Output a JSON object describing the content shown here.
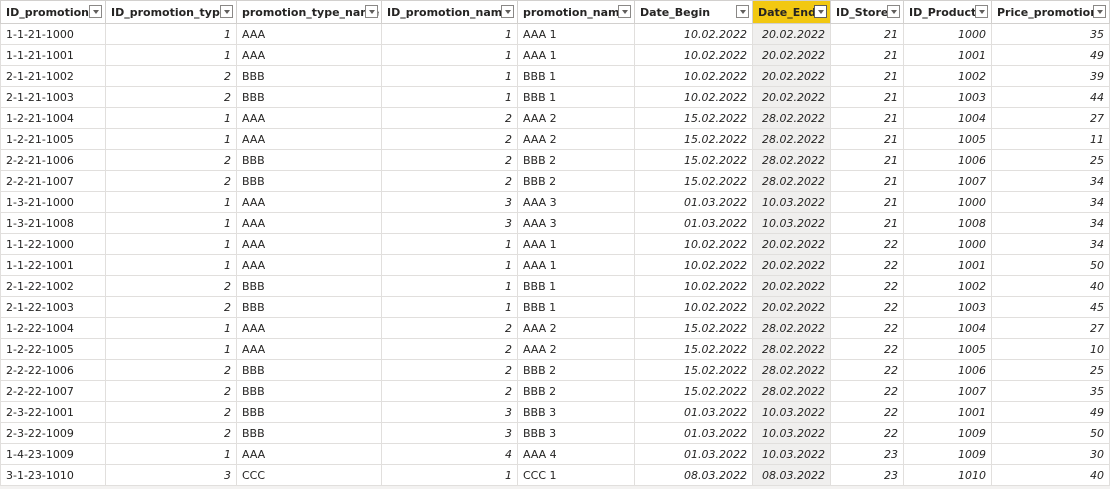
{
  "columns": [
    {
      "label": "ID_promotion",
      "align": "txt"
    },
    {
      "label": "ID_promotion_type",
      "align": "num"
    },
    {
      "label": "promotion_type_name",
      "align": "txt"
    },
    {
      "label": "ID_promotion_name",
      "align": "num"
    },
    {
      "label": "promotion_name",
      "align": "txt"
    },
    {
      "label": "Date_Begin",
      "align": "num"
    },
    {
      "label": "Date_End",
      "align": "num",
      "active": true
    },
    {
      "label": "ID_Store",
      "align": "num"
    },
    {
      "label": "ID_Product",
      "align": "num"
    },
    {
      "label": "Price_promotion",
      "align": "num"
    }
  ],
  "rows": [
    [
      "1-1-21-1000",
      "1",
      "AAA",
      "1",
      "AAA 1",
      "10.02.2022",
      "20.02.2022",
      "21",
      "1000",
      "35"
    ],
    [
      "1-1-21-1001",
      "1",
      "AAA",
      "1",
      "AAA 1",
      "10.02.2022",
      "20.02.2022",
      "21",
      "1001",
      "49"
    ],
    [
      "2-1-21-1002",
      "2",
      "BBB",
      "1",
      "BBB 1",
      "10.02.2022",
      "20.02.2022",
      "21",
      "1002",
      "39"
    ],
    [
      "2-1-21-1003",
      "2",
      "BBB",
      "1",
      "BBB 1",
      "10.02.2022",
      "20.02.2022",
      "21",
      "1003",
      "44"
    ],
    [
      "1-2-21-1004",
      "1",
      "AAA",
      "2",
      "AAA 2",
      "15.02.2022",
      "28.02.2022",
      "21",
      "1004",
      "27"
    ],
    [
      "1-2-21-1005",
      "1",
      "AAA",
      "2",
      "AAA 2",
      "15.02.2022",
      "28.02.2022",
      "21",
      "1005",
      "11"
    ],
    [
      "2-2-21-1006",
      "2",
      "BBB",
      "2",
      "BBB 2",
      "15.02.2022",
      "28.02.2022",
      "21",
      "1006",
      "25"
    ],
    [
      "2-2-21-1007",
      "2",
      "BBB",
      "2",
      "BBB 2",
      "15.02.2022",
      "28.02.2022",
      "21",
      "1007",
      "34"
    ],
    [
      "1-3-21-1000",
      "1",
      "AAA",
      "3",
      "AAA 3",
      "01.03.2022",
      "10.03.2022",
      "21",
      "1000",
      "34"
    ],
    [
      "1-3-21-1008",
      "1",
      "AAA",
      "3",
      "AAA 3",
      "01.03.2022",
      "10.03.2022",
      "21",
      "1008",
      "34"
    ],
    [
      "1-1-22-1000",
      "1",
      "AAA",
      "1",
      "AAA 1",
      "10.02.2022",
      "20.02.2022",
      "22",
      "1000",
      "34"
    ],
    [
      "1-1-22-1001",
      "1",
      "AAA",
      "1",
      "AAA 1",
      "10.02.2022",
      "20.02.2022",
      "22",
      "1001",
      "50"
    ],
    [
      "2-1-22-1002",
      "2",
      "BBB",
      "1",
      "BBB 1",
      "10.02.2022",
      "20.02.2022",
      "22",
      "1002",
      "40"
    ],
    [
      "2-1-22-1003",
      "2",
      "BBB",
      "1",
      "BBB 1",
      "10.02.2022",
      "20.02.2022",
      "22",
      "1003",
      "45"
    ],
    [
      "1-2-22-1004",
      "1",
      "AAA",
      "2",
      "AAA 2",
      "15.02.2022",
      "28.02.2022",
      "22",
      "1004",
      "27"
    ],
    [
      "1-2-22-1005",
      "1",
      "AAA",
      "2",
      "AAA 2",
      "15.02.2022",
      "28.02.2022",
      "22",
      "1005",
      "10"
    ],
    [
      "2-2-22-1006",
      "2",
      "BBB",
      "2",
      "BBB 2",
      "15.02.2022",
      "28.02.2022",
      "22",
      "1006",
      "25"
    ],
    [
      "2-2-22-1007",
      "2",
      "BBB",
      "2",
      "BBB 2",
      "15.02.2022",
      "28.02.2022",
      "22",
      "1007",
      "35"
    ],
    [
      "2-3-22-1001",
      "2",
      "BBB",
      "3",
      "BBB 3",
      "01.03.2022",
      "10.03.2022",
      "22",
      "1001",
      "49"
    ],
    [
      "2-3-22-1009",
      "2",
      "BBB",
      "3",
      "BBB 3",
      "01.03.2022",
      "10.03.2022",
      "22",
      "1009",
      "50"
    ],
    [
      "1-4-23-1009",
      "1",
      "AAA",
      "4",
      "AAA 4",
      "01.03.2022",
      "10.03.2022",
      "23",
      "1009",
      "30"
    ],
    [
      "3-1-23-1010",
      "3",
      "CCC",
      "1",
      "CCC 1",
      "08.03.2022",
      "08.03.2022",
      "23",
      "1010",
      "40"
    ]
  ],
  "icons": {
    "filter": "chevron-down-icon"
  },
  "colors": {
    "active_header": "#f2c811",
    "selected_column": "#f0efee",
    "grid_line": "#e1dfdd"
  }
}
